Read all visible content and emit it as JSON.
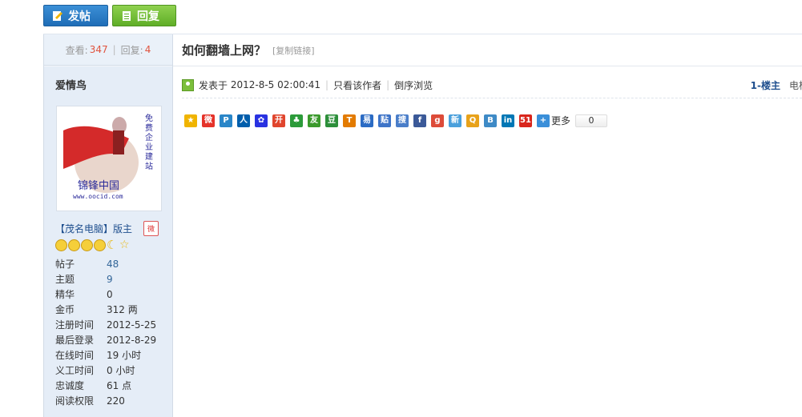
{
  "toolbar": {
    "post_label": "发帖",
    "reply_label": "回复"
  },
  "sidebar": {
    "views_label": "查看:",
    "views_value": "347",
    "replies_label": "回复:",
    "replies_value": "4",
    "author": "爱情鸟",
    "avatar": {
      "vertical_text": "免费企业建站",
      "brand": "锦锋中国",
      "url": "www.oocid.com",
      "side_text": "锦锋中国"
    },
    "group": "【茂名电脑】版主",
    "profile": [
      {
        "k": "帖子",
        "v": "48"
      },
      {
        "k": "主题",
        "v": "9"
      },
      {
        "k": "精华",
        "v": "0"
      },
      {
        "k": "金币",
        "v": "312 两"
      },
      {
        "k": "注册时间",
        "v": "2012-5-25"
      },
      {
        "k": "最后登录",
        "v": "2012-8-29"
      },
      {
        "k": "在线时间",
        "v": "19 小时"
      },
      {
        "k": "义工时间",
        "v": "0 小时"
      },
      {
        "k": "忠诚度",
        "v": "61 点"
      },
      {
        "k": "阅读权限",
        "v": "220"
      }
    ]
  },
  "post": {
    "title": "如何翻墙上网？",
    "copy_link": "[复制链接]",
    "posted_prefix": "发表于",
    "posted_time": "2012-8-5 02:00:41",
    "only_author": "只看该作者",
    "reverse_order": "倒序浏览",
    "floor": "1-楼主",
    "cut_text": "电梯"
  },
  "share": {
    "more_label": "更多",
    "count": "0",
    "icons": [
      {
        "name": "qzone-icon",
        "glyph": "★",
        "color": "#f0b400"
      },
      {
        "name": "weibo-icon",
        "glyph": "微",
        "color": "#e5332a"
      },
      {
        "name": "tencent-weibo-icon",
        "glyph": "P",
        "color": "#2a86c8"
      },
      {
        "name": "renren-icon",
        "glyph": "人",
        "color": "#005eac"
      },
      {
        "name": "baidu-icon",
        "glyph": "✿",
        "color": "#2932e1"
      },
      {
        "name": "kaixin-icon",
        "glyph": "开",
        "color": "#e0452d"
      },
      {
        "name": "clover-icon",
        "glyph": "♣",
        "color": "#2c9b3a"
      },
      {
        "name": "pengyou-icon",
        "glyph": "友",
        "color": "#3b9a2c"
      },
      {
        "name": "douban-icon",
        "glyph": "豆",
        "color": "#2c8f3a"
      },
      {
        "name": "tianya-icon",
        "glyph": "T",
        "color": "#e37b00"
      },
      {
        "name": "wangyi-icon",
        "glyph": "易",
        "color": "#2b6bc4"
      },
      {
        "name": "tieba-icon",
        "glyph": "贴",
        "color": "#3e74c8"
      },
      {
        "name": "sohu-icon",
        "glyph": "搜",
        "color": "#4a7ec9"
      },
      {
        "name": "facebook-icon",
        "glyph": "f",
        "color": "#3b5998"
      },
      {
        "name": "google-icon",
        "glyph": "g",
        "color": "#dd4b39"
      },
      {
        "name": "sina-icon",
        "glyph": "新",
        "color": "#4aa0dc"
      },
      {
        "name": "qq-icon",
        "glyph": "Q",
        "color": "#e8a21a"
      },
      {
        "name": "blog-icon",
        "glyph": "B",
        "color": "#3e8ac6"
      },
      {
        "name": "linkedin-icon",
        "glyph": "in",
        "color": "#0077b5"
      },
      {
        "name": "51-icon",
        "glyph": "51",
        "color": "#d9261c"
      },
      {
        "name": "more-plus-icon",
        "glyph": "+",
        "color": "#3a8fd9"
      }
    ]
  }
}
